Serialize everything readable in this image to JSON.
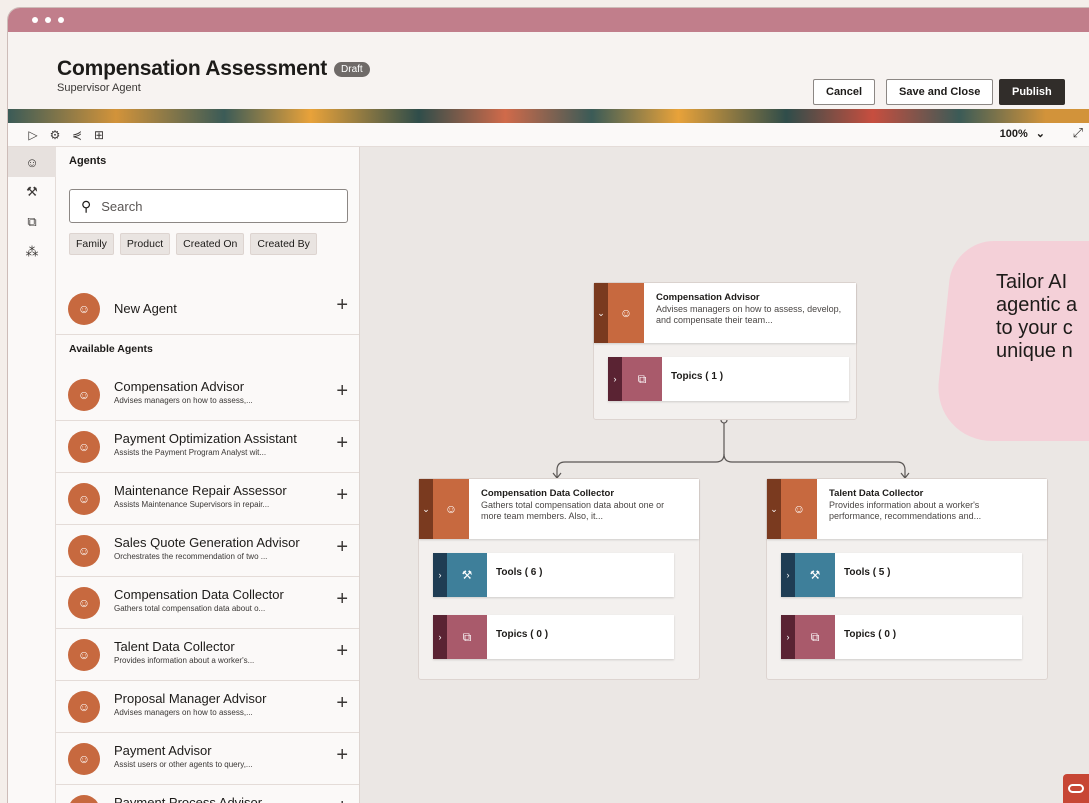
{
  "header": {
    "title": "Compensation Assessment",
    "badge": "Draft",
    "subtitle": "Supervisor Agent",
    "cancel_label": "Cancel",
    "save_close_label": "Save and Close",
    "publish_label": "Publish"
  },
  "toolbar": {
    "zoom": "100%",
    "icons": [
      "play-icon",
      "settings-icon",
      "share-icon",
      "grid-icon",
      "chevron-down-icon",
      "expand-icon"
    ]
  },
  "rail": {
    "items": [
      "agents-icon",
      "tools-icon",
      "topics-icon",
      "workflow-icon"
    ]
  },
  "sidebar": {
    "heading": "Agents",
    "search_placeholder": "Search",
    "filters": [
      "Family",
      "Product",
      "Created On",
      "Created By"
    ],
    "new_agent_label": "New Agent",
    "available_label": "Available Agents",
    "agents": [
      {
        "name": "Compensation Advisor",
        "desc": "Advises managers on how to assess,..."
      },
      {
        "name": "Payment Optimization Assistant",
        "desc": "Assists the Payment Program Analyst wit..."
      },
      {
        "name": "Maintenance Repair Assessor",
        "desc": "Assists Maintenance Supervisors in repair..."
      },
      {
        "name": "Sales Quote Generation Advisor",
        "desc": "Orchestrates the recommendation of two ..."
      },
      {
        "name": "Compensation Data Collector",
        "desc": "Gathers total compensation data about o..."
      },
      {
        "name": "Talent Data Collector",
        "desc": "Provides information about a worker's..."
      },
      {
        "name": "Proposal Manager Advisor",
        "desc": "Advises managers on how to assess,..."
      },
      {
        "name": "Payment Advisor",
        "desc": "Assist users or other agents to query,..."
      },
      {
        "name": "Payment Process Advisor",
        "desc": ""
      }
    ]
  },
  "canvas": {
    "root": {
      "title": "Compensation Advisor",
      "desc": "Advises managers on how to assess, develop, and compensate their team...",
      "topics": "Topics ( 1 )"
    },
    "left": {
      "title": "Compensation Data Collector",
      "desc": "Gathers total compensation data about one or more team members. Also, it...",
      "tools": "Tools ( 6 )",
      "topics": "Topics ( 0 )"
    },
    "right": {
      "title": "Talent Data Collector",
      "desc": "Provides information about a worker's performance, recommendations and...",
      "tools": "Tools ( 5 )",
      "topics": "Topics ( 0 )"
    },
    "callout": "Tailor AI agentic a to your c unique n"
  },
  "colors": {
    "titlebar": "#c17e8b",
    "agent_accent": "#c7693f",
    "topics_accent": "#a95a6b",
    "tools_accent": "#3e7f9a",
    "callout": "#f4d0d8",
    "oracle_red": "#c74634"
  }
}
